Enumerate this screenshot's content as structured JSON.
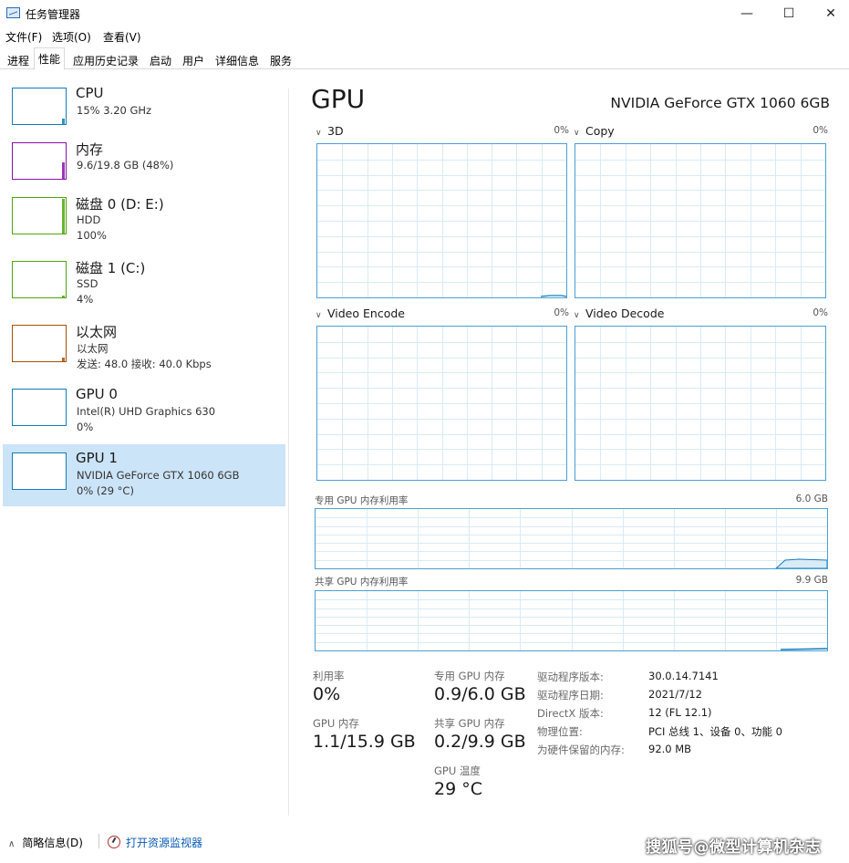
{
  "window": {
    "title": "任务管理器",
    "minimize": "—",
    "maximize": "☐",
    "close": "✕"
  },
  "menu": [
    "文件(F)",
    "选项(O)",
    "查看(V)"
  ],
  "tabs": [
    "进程",
    "性能",
    "应用历史记录",
    "启动",
    "用户",
    "详细信息",
    "服务"
  ],
  "active_tab": "性能",
  "sidebar": {
    "items": [
      {
        "name": "CPU",
        "line1": "15% 3.20 GHz",
        "line2": "",
        "color": "#117dbb",
        "level": 0.15
      },
      {
        "name": "内存",
        "line1": "9.6/19.8 GB (48%)",
        "line2": "",
        "color": "#8b12ae",
        "level": 0.48
      },
      {
        "name": "磁盘 0 (D: E:)",
        "line1": "HDD",
        "line2": "100%",
        "color": "#4da60c",
        "level": 1.0
      },
      {
        "name": "磁盘 1 (C:)",
        "line1": "SSD",
        "line2": "4%",
        "color": "#4da60c",
        "level": 0.04
      },
      {
        "name": "以太网",
        "line1": "以太网",
        "line2": "发送: 48.0 接收: 40.0 Kbps",
        "color": "#a74f01",
        "level": 0.1
      },
      {
        "name": "GPU 0",
        "line1": "Intel(R) UHD Graphics 630",
        "line2": "0%",
        "color": "#117dbb",
        "level": 0
      },
      {
        "name": "GPU 1",
        "line1": "NVIDIA GeForce GTX 1060 6GB",
        "line2": "0% (29 °C)",
        "color": "#117dbb",
        "level": 0
      }
    ]
  },
  "main": {
    "title": "GPU",
    "model": "NVIDIA GeForce GTX 1060 6GB",
    "engines": [
      {
        "label": "3D",
        "pct": "0%"
      },
      {
        "label": "Copy",
        "pct": "0%"
      },
      {
        "label": "Video Encode",
        "pct": "0%"
      },
      {
        "label": "Video Decode",
        "pct": "0%"
      }
    ],
    "dedicated_mem": {
      "label": "专用 GPU 内存利用率",
      "max": "6.0 GB"
    },
    "shared_mem": {
      "label": "共享 GPU 内存利用率",
      "max": "9.9 GB"
    },
    "stats": {
      "utilization_label": "利用率",
      "utilization": "0%",
      "dedicated_label": "专用 GPU 内存",
      "dedicated": "0.9/6.0 GB",
      "gpu_mem_label": "GPU 内存",
      "gpu_mem": "1.1/15.9 GB",
      "shared_label": "共享 GPU 内存",
      "shared": "0.2/9.9 GB",
      "temp_label": "GPU 温度",
      "temp": "29 °C"
    },
    "info": [
      {
        "label": "驱动程序版本:",
        "value": "30.0.14.7141"
      },
      {
        "label": "驱动程序日期:",
        "value": "2021/7/12"
      },
      {
        "label": "DirectX 版本:",
        "value": "12 (FL 12.1)"
      },
      {
        "label": "物理位置:",
        "value": "PCI 总线 1、设备 0、功能 0"
      },
      {
        "label": "为硬件保留的内存:",
        "value": "92.0 MB"
      }
    ]
  },
  "footer": {
    "summary": "简略信息(D)",
    "resmon": "打开资源监视器"
  },
  "watermark": "搜狐号@微型计算机杂志",
  "colors": {
    "graph_border": "#4aa0d6",
    "selected_bg": "#cce4f7",
    "link": "#0a5cb4"
  }
}
